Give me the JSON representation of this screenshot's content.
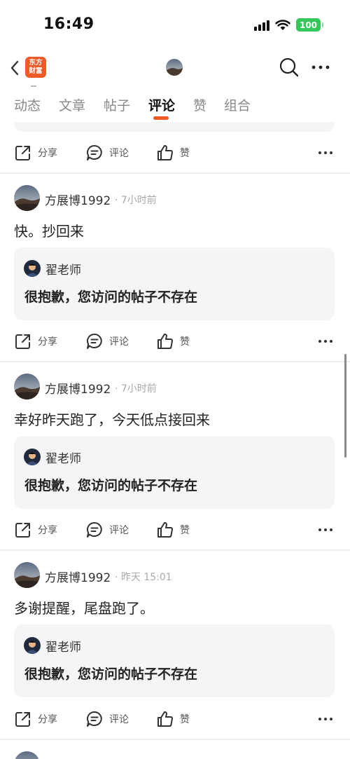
{
  "status_bar": {
    "time": "16:49",
    "battery": "100"
  },
  "app": {
    "logo_line1": "东方",
    "logo_line2": "财富"
  },
  "tabs": [
    {
      "label": "动态",
      "active": false
    },
    {
      "label": "文章",
      "active": false
    },
    {
      "label": "帖子",
      "active": false
    },
    {
      "label": "评论",
      "active": true
    },
    {
      "label": "赞",
      "active": false
    },
    {
      "label": "组合",
      "active": false
    }
  ],
  "actions": {
    "share": "分享",
    "comment": "评论",
    "like": "赞"
  },
  "posts": [
    {
      "author": "方展博1992",
      "time": "· 7小时前",
      "text": "快。抄回来",
      "quote": {
        "author": "翟老师",
        "text": "很抱歉，您访问的帖子不存在"
      }
    },
    {
      "author": "方展博1992",
      "time": "· 7小时前",
      "text": "幸好昨天跑了，今天低点接回来",
      "quote": {
        "author": "翟老师",
        "text": "很抱歉，您访问的帖子不存在"
      }
    },
    {
      "author": "方展博1992",
      "time": "· 昨天 15:01",
      "text": "多谢提醒，尾盘跑了。",
      "quote": {
        "author": "翟老师",
        "text": "很抱歉，您访问的帖子不存在"
      }
    }
  ],
  "colors": {
    "accent": "#f05a24",
    "battery": "#34c759",
    "quote_bg": "#f5f5f7"
  }
}
